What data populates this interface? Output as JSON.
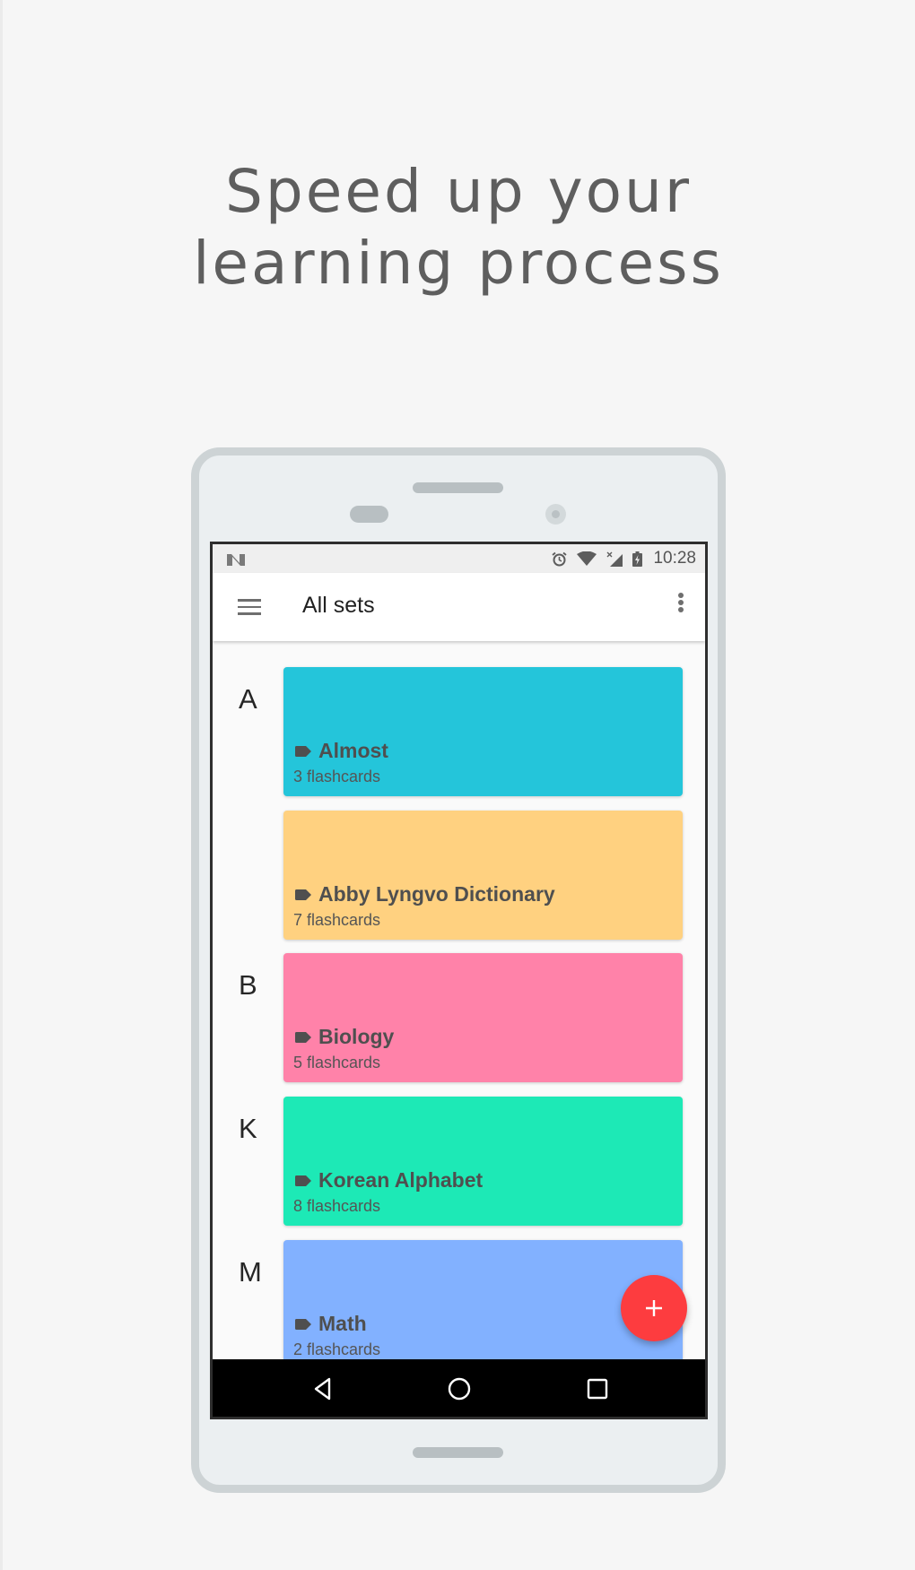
{
  "headline": {
    "line1": "Speed up your",
    "line2": "learning process"
  },
  "status_bar": {
    "notification_icon": "n-logo-icon",
    "icons": [
      "alarm-icon",
      "wifi-icon",
      "signal-no-data-icon",
      "battery-charging-icon"
    ],
    "time": "10:28"
  },
  "app_bar": {
    "menu_icon": "hamburger-menu-icon",
    "title": "All sets",
    "overflow_icon": "more-vert-icon"
  },
  "sets": [
    {
      "section": "A",
      "name": "Almost",
      "count": "3 flashcards",
      "color": "#24c5da"
    },
    {
      "section": "",
      "name": "Abby Lyngvo Dictionary",
      "count": "7 flashcards",
      "color": "#ffd180"
    },
    {
      "section": "B",
      "name": "Biology",
      "count": "5 flashcards",
      "color": "#ff82a9"
    },
    {
      "section": "K",
      "name": "Korean Alphabet",
      "count": "8 flashcards",
      "color": "#1de9b6"
    },
    {
      "section": "M",
      "name": "Math",
      "count": "2 flashcards",
      "color": "#82b1ff"
    }
  ],
  "fab": {
    "icon": "plus-icon",
    "color": "#fd3c3f"
  },
  "nav_bar": {
    "buttons": [
      "back-icon",
      "home-icon",
      "recents-icon"
    ]
  }
}
